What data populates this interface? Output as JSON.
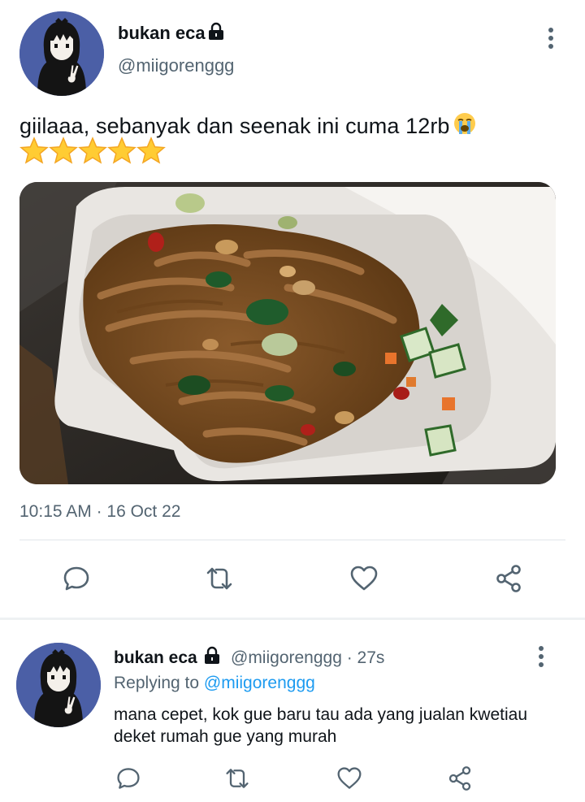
{
  "tweet": {
    "display_name": "bukan eca",
    "handle": "@miigorenggg",
    "text": "giilaaa, sebanyak dan seenak ini cuma 12rb",
    "emoji": "loudly-crying-face",
    "rating_stars": 5,
    "image_description_icon": "food-photo",
    "time": "10:15 AM",
    "separator": " · ",
    "date": "16 Oct 22"
  },
  "actions": {
    "reply_icon": "reply-icon",
    "retweet_icon": "retweet-icon",
    "like_icon": "heart-icon",
    "share_icon": "share-icon"
  },
  "reply": {
    "display_name": "bukan eca",
    "handle": "@miigorenggg",
    "age": "27s",
    "meta": "@miigorenggg · 27s",
    "replying_prefix": "Replying to ",
    "replying_to": "@miigorenggg",
    "text": "mana cepet, kok gue baru tau ada yang jualan kwetiau deket rumah gue yang murah"
  },
  "colors": {
    "text_primary": "#0f1419",
    "text_secondary": "#536471",
    "link": "#1d9bf0",
    "avatar_bg": "#4b5fa6"
  }
}
